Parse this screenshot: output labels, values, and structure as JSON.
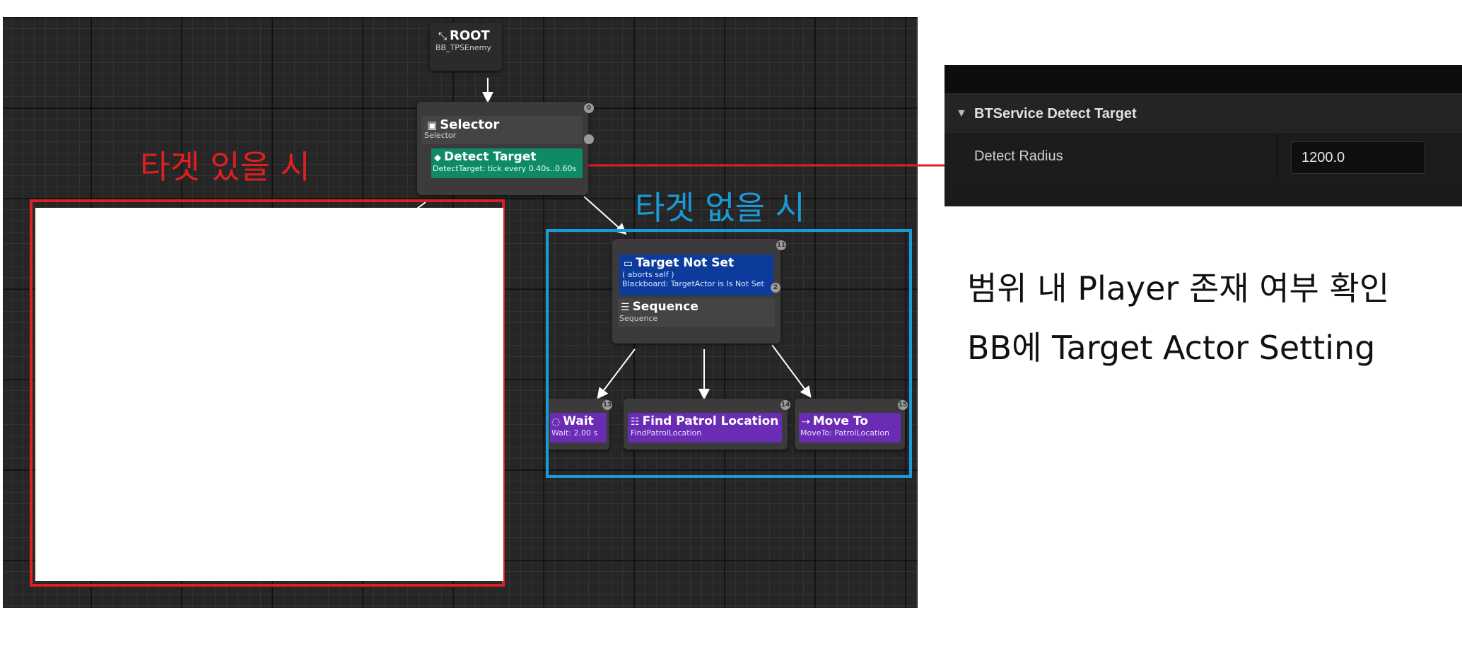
{
  "root": {
    "title": "ROOT",
    "subtitle": "BB_TPSEnemy"
  },
  "selector": {
    "title": "Selector",
    "subtitle": "Selector",
    "pin": "0"
  },
  "service": {
    "title": "Detect Target",
    "subtitle": "DetectTarget: tick every 0.40s..0.60s"
  },
  "decorator": {
    "title": "Target Not Set",
    "line1": "( aborts self )",
    "line2": "Blackboard: TargetActor is Is Not Set",
    "pin": "2"
  },
  "sequence": {
    "title": "Sequence",
    "subtitle": "Sequence",
    "pin": "11"
  },
  "tasks": [
    {
      "title": "Wait",
      "subtitle": "Wait: 2.00 s",
      "pin": "13"
    },
    {
      "title": "Find Patrol Location",
      "subtitle": "FindPatrolLocation",
      "pin": "14"
    },
    {
      "title": "Move To",
      "subtitle": "MoveTo: PatrolLocation",
      "pin": "15"
    }
  ],
  "labels": {
    "with_target": "타겟 있을 시",
    "without_target": "타겟 없을 시"
  },
  "details": {
    "section": "BTService Detect Target",
    "property": "Detect Radius",
    "value": "1200.0"
  },
  "notes": {
    "line1": "범위 내 Player 존재 여부 확인",
    "line2": "BB에 Target Actor Setting"
  },
  "colors": {
    "service": "#0f8a66",
    "decorator": "#0d3b9c",
    "task": "#6a2bb5",
    "red": "#e02020",
    "blue": "#1a9ad6"
  }
}
